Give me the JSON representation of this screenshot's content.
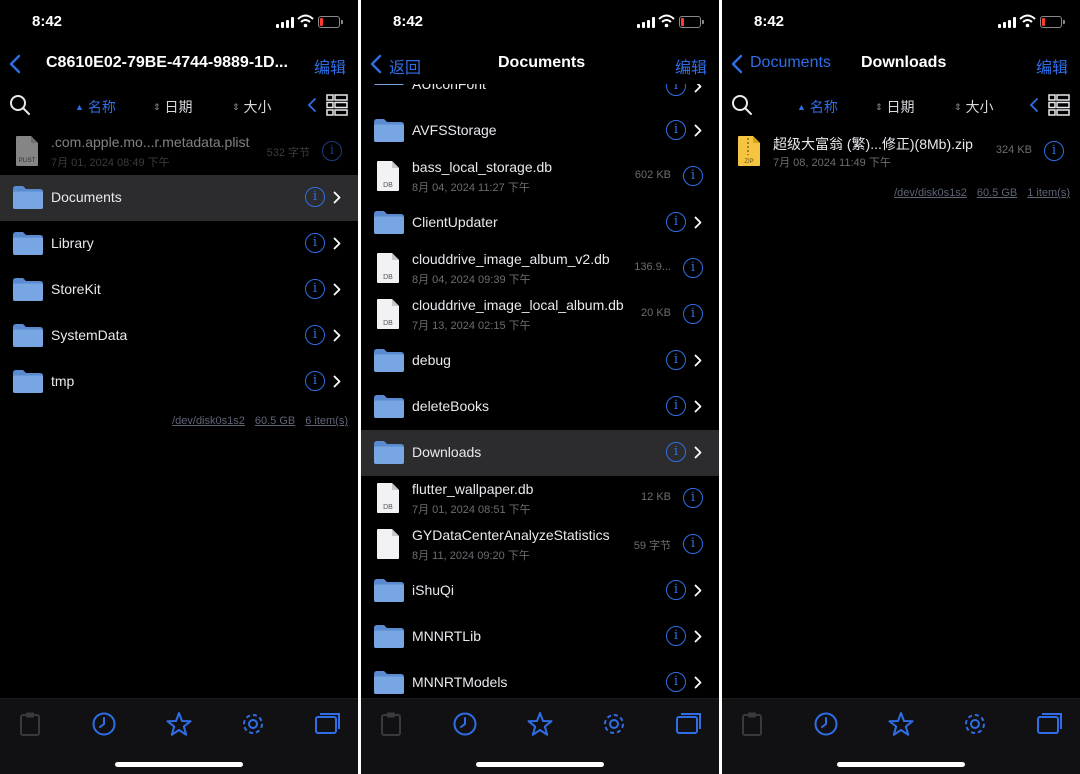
{
  "status": {
    "time": "8:42"
  },
  "panel1": {
    "title": "C8610E02-79BE-4744-9889-1D...",
    "edit": "编辑",
    "sort": [
      "名称",
      "日期",
      "大小"
    ],
    "items": [
      {
        "name": ".com.apple.mo...r.metadata.plist",
        "date": "7月 01, 2024 08:49 下午",
        "size": "532 字节"
      },
      {
        "name": "Documents"
      },
      {
        "name": "Library"
      },
      {
        "name": "StoreKit"
      },
      {
        "name": "SystemData"
      },
      {
        "name": "tmp"
      }
    ],
    "footer": {
      "disk": "/dev/disk0s1s2",
      "free": "60.5 GB",
      "count": "6 item(s)"
    }
  },
  "panel2": {
    "back": "返回",
    "title": "Documents",
    "edit": "编辑",
    "items": [
      {
        "name": "AUIconFont"
      },
      {
        "name": "AVFSStorage"
      },
      {
        "name": "bass_local_storage.db",
        "date": "8月 04, 2024 11:27 下午",
        "size": "602 KB"
      },
      {
        "name": "ClientUpdater"
      },
      {
        "name": "clouddrive_image_album_v2.db",
        "date": "8月 04, 2024 09:39 下午",
        "size": "136.9..."
      },
      {
        "name": "clouddrive_image_local_album.db",
        "date": "7月 13, 2024 02:15 下午",
        "size": "20 KB"
      },
      {
        "name": "debug"
      },
      {
        "name": "deleteBooks"
      },
      {
        "name": "Downloads"
      },
      {
        "name": "flutter_wallpaper.db",
        "date": "7月 01, 2024 08:51 下午",
        "size": "12 KB"
      },
      {
        "name": "GYDataCenterAnalyzeStatistics",
        "date": "8月 11, 2024 09:20 下午",
        "size": "59 字节"
      },
      {
        "name": "iShuQi"
      },
      {
        "name": "MNNRTLib"
      },
      {
        "name": "MNNRTModels"
      }
    ]
  },
  "panel3": {
    "back": "Documents",
    "title": "Downloads",
    "edit": "编辑",
    "sort": [
      "名称",
      "日期",
      "大小"
    ],
    "items": [
      {
        "name": "超级大富翁 (繁)...修正)(8Mb).zip",
        "date": "7月 08, 2024 11:49 下午",
        "size": "324 KB"
      }
    ],
    "footer": {
      "disk": "/dev/disk0s1s2",
      "free": "60.5 GB",
      "count": "1 item(s)"
    }
  },
  "tabs": [
    "clipboard-icon",
    "clock-icon",
    "star-icon",
    "gear-icon",
    "windows-icon"
  ],
  "colors": {
    "accent": "#2f6ee6",
    "background": "#000000",
    "folder": "#6f9fdc",
    "selected_row": "#2c2c2e"
  }
}
